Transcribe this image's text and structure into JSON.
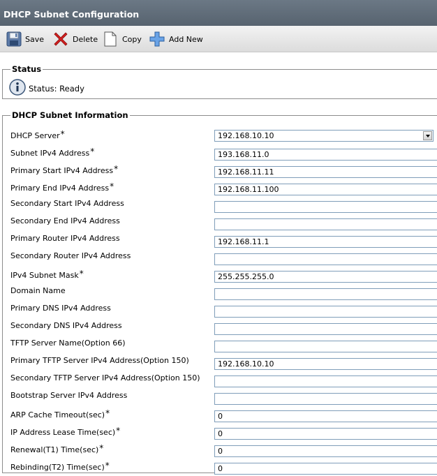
{
  "window": {
    "title": "DHCP Subnet Configuration"
  },
  "toolbar": {
    "save_label": "Save",
    "delete_label": "Delete",
    "copy_label": "Copy",
    "add_new_label": "Add New"
  },
  "status": {
    "legend": "Status",
    "text": "Status: Ready"
  },
  "subnet_info": {
    "legend": "DHCP Subnet Information",
    "required_marker": "*",
    "fields": [
      {
        "label": "DHCP Server",
        "required": true,
        "type": "select",
        "value": "192.168.10.10"
      },
      {
        "label": "Subnet IPv4 Address",
        "required": true,
        "type": "text",
        "value": "193.168.11.0"
      },
      {
        "label": "Primary Start IPv4 Address",
        "required": true,
        "type": "text",
        "value": "192.168.11.11"
      },
      {
        "label": "Primary End IPv4 Address",
        "required": true,
        "type": "text",
        "value": "192.168.11.100"
      },
      {
        "label": "Secondary Start IPv4 Address",
        "required": false,
        "type": "text",
        "value": ""
      },
      {
        "label": "Secondary End IPv4 Address",
        "required": false,
        "type": "text",
        "value": ""
      },
      {
        "label": "Primary Router IPv4 Address",
        "required": false,
        "type": "text",
        "value": "192.168.11.1"
      },
      {
        "label": "Secondary Router IPv4 Address",
        "required": false,
        "type": "text",
        "value": ""
      },
      {
        "label": "IPv4 Subnet Mask",
        "required": true,
        "type": "text",
        "value": "255.255.255.0"
      },
      {
        "label": "Domain Name",
        "required": false,
        "type": "text",
        "value": ""
      },
      {
        "label": "Primary DNS IPv4 Address",
        "required": false,
        "type": "text",
        "value": ""
      },
      {
        "label": "Secondary DNS IPv4 Address",
        "required": false,
        "type": "text",
        "value": ""
      },
      {
        "label": "TFTP Server Name(Option 66)",
        "required": false,
        "type": "text",
        "value": ""
      },
      {
        "label": "Primary TFTP Server IPv4 Address(Option 150)",
        "required": false,
        "type": "text",
        "value": "192.168.10.10"
      },
      {
        "label": "Secondary TFTP Server IPv4 Address(Option 150)",
        "required": false,
        "type": "text",
        "value": ""
      },
      {
        "label": "Bootstrap Server IPv4 Address",
        "required": false,
        "type": "text",
        "value": ""
      },
      {
        "label": "ARP Cache Timeout(sec)",
        "required": true,
        "type": "text",
        "value": "0"
      },
      {
        "label": "IP Address Lease Time(sec)",
        "required": true,
        "type": "text",
        "value": "0"
      },
      {
        "label": "Renewal(T1) Time(sec)",
        "required": true,
        "type": "text",
        "value": "0"
      },
      {
        "label": "Rebinding(T2) Time(sec)",
        "required": true,
        "type": "text",
        "value": "0"
      }
    ]
  },
  "icons": {
    "save": "floppy-disk-icon",
    "delete": "red-x-icon",
    "copy": "document-copy-icon",
    "add_new": "blue-plus-icon",
    "status": "info-icon"
  },
  "colors": {
    "titlebar": "#5f6b77",
    "delete_red": "#d42020",
    "add_blue": "#3c7fd0",
    "field_border": "#7f9db9"
  }
}
